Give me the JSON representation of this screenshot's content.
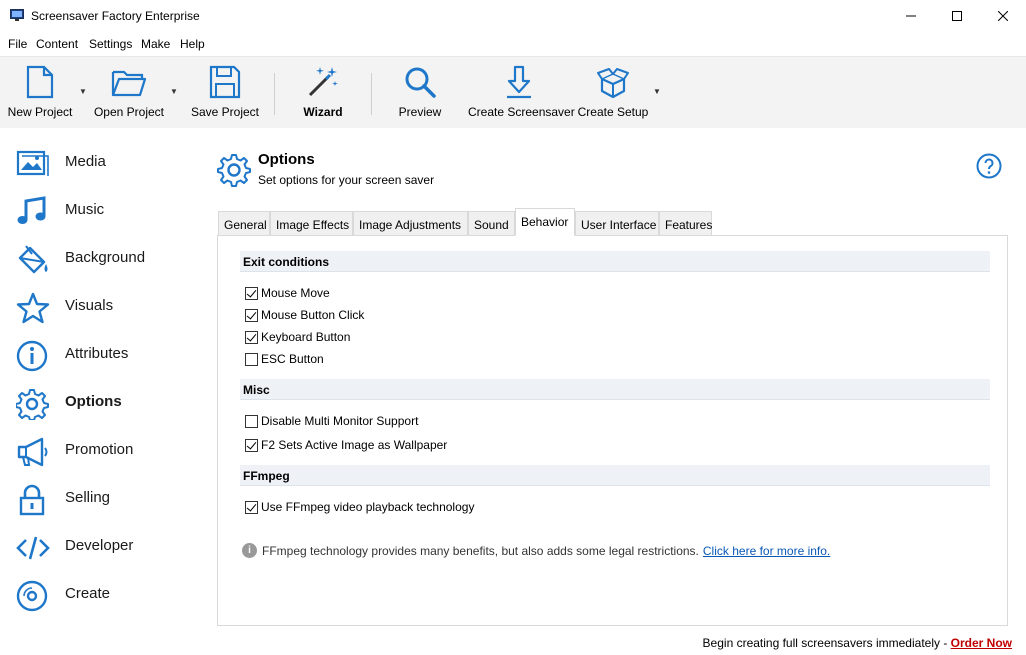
{
  "window": {
    "title": "Screensaver Factory Enterprise"
  },
  "menu": [
    "File",
    "Content",
    "Settings",
    "Make",
    "Help"
  ],
  "toolbar": {
    "new_project": "New Project",
    "open_project": "Open Project",
    "save_project": "Save Project",
    "wizard": "Wizard",
    "preview": "Preview",
    "create_screensaver": "Create Screensaver",
    "create_setup": "Create Setup"
  },
  "sidebar": {
    "items": [
      {
        "label": "Media",
        "icon": "image-icon"
      },
      {
        "label": "Music",
        "icon": "music-note-icon"
      },
      {
        "label": "Background",
        "icon": "paint-bucket-icon"
      },
      {
        "label": "Visuals",
        "icon": "star-icon"
      },
      {
        "label": "Attributes",
        "icon": "info-icon"
      },
      {
        "label": "Options",
        "icon": "gear-icon",
        "active": true
      },
      {
        "label": "Promotion",
        "icon": "megaphone-icon"
      },
      {
        "label": "Selling",
        "icon": "lock-icon"
      },
      {
        "label": "Developer",
        "icon": "code-icon"
      },
      {
        "label": "Create",
        "icon": "disc-icon"
      }
    ]
  },
  "header": {
    "title": "Options",
    "subtitle": "Set options for your screen saver"
  },
  "tabs": [
    "General",
    "Image Effects",
    "Image Adjustments",
    "Sound",
    "Behavior",
    "User Interface",
    "Features"
  ],
  "active_tab": "Behavior",
  "sections": {
    "exit": {
      "title": "Exit conditions",
      "mouse_move": "Mouse Move",
      "mouse_button_click": "Mouse Button Click",
      "keyboard_button": "Keyboard Button",
      "esc_button": "ESC Button"
    },
    "misc": {
      "title": "Misc",
      "disable_multi_monitor": "Disable Multi Monitor Support",
      "f2_wallpaper": "F2 Sets Active Image as Wallpaper"
    },
    "ffmpeg": {
      "title": "FFmpeg",
      "use_ffmpeg": "Use FFmpeg video playback technology"
    }
  },
  "checks": {
    "mouse_move": true,
    "mouse_button_click": true,
    "keyboard_button": true,
    "esc_button": false,
    "disable_multi_monitor": false,
    "f2_wallpaper": true,
    "use_ffmpeg": true
  },
  "info": {
    "text": "FFmpeg technology provides many benefits, but also adds some legal restrictions.",
    "link": "Click here for more info."
  },
  "status": {
    "text": "Begin creating full screensavers immediately - ",
    "link": "Order Now"
  },
  "colors": {
    "accent": "#1f77c9",
    "link": "#0a58b8",
    "order": "#c00000"
  }
}
